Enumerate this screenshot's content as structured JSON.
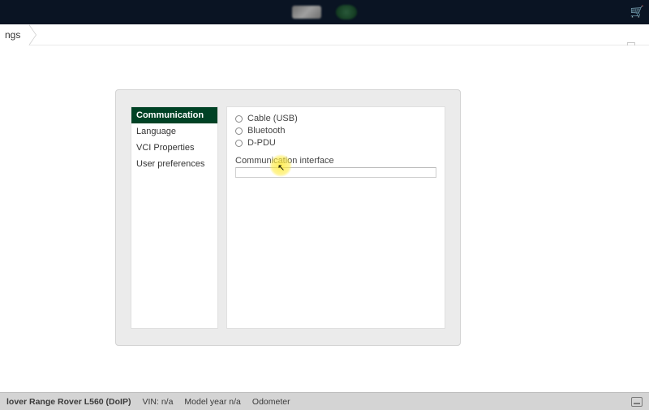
{
  "breadcrumb": {
    "current": "ngs"
  },
  "settings": {
    "sidebar": {
      "items": [
        {
          "label": "Communication",
          "active": true
        },
        {
          "label": "Language",
          "active": false
        },
        {
          "label": "VCI Properties",
          "active": false
        },
        {
          "label": "User preferences",
          "active": false
        }
      ]
    },
    "communication": {
      "options": [
        {
          "label": "Cable (USB)"
        },
        {
          "label": "Bluetooth"
        },
        {
          "label": "D-PDU"
        }
      ],
      "interface_label": "Communication interface",
      "interface_value": ""
    }
  },
  "status": {
    "vehicle": "lover Range Rover L560 (DoIP)",
    "vin_label": "VIN:",
    "vin_value": "n/a",
    "model_year_label": "Model year",
    "model_year_value": "n/a",
    "odometer_label": "Odometer"
  }
}
